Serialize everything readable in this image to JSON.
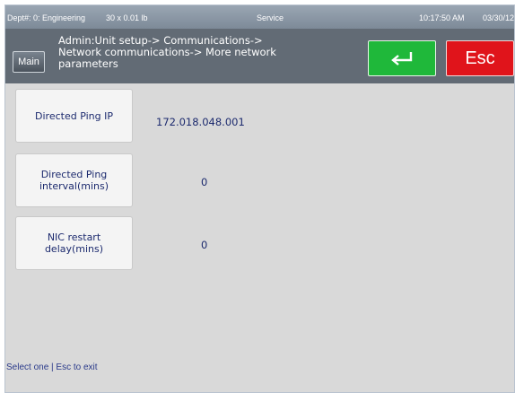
{
  "status_bar": {
    "dept": "Dept#: 0: Engineering",
    "weight": "30 x 0.01 lb",
    "mode": "Service",
    "time": "10:17:50 AM",
    "date": "03/30/12"
  },
  "header": {
    "main_label": "Main",
    "breadcrumb_lines": [
      "Admin:Unit setup-> Communications->",
      "Network communications-> More network",
      "parameters"
    ],
    "enter_icon": "enter-return-arrow",
    "esc_label": "Esc"
  },
  "colors": {
    "enter_button": "#1fb83a",
    "esc_button": "#e0141b",
    "header_bg": "#626b75",
    "text_blue": "#1c2a6e"
  },
  "parameters": [
    {
      "label_lines": [
        "Directed Ping IP"
      ],
      "value": "172.018.048.001"
    },
    {
      "label_lines": [
        "Directed Ping",
        "interval(mins)"
      ],
      "value": "0"
    },
    {
      "label_lines": [
        "NIC restart",
        "delay(mins)"
      ],
      "value": "0"
    }
  ],
  "footer": {
    "hint": "Select one | Esc to exit"
  }
}
